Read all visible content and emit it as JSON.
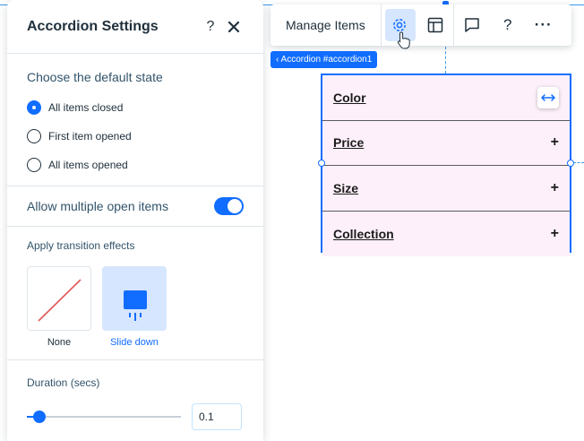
{
  "panel": {
    "title": "Accordion Settings",
    "help_label": "?",
    "close_label": "✕",
    "default_state": {
      "label": "Choose the default state",
      "options": [
        {
          "label": "All items closed",
          "checked": true
        },
        {
          "label": "First item opened",
          "checked": false
        },
        {
          "label": "All items opened",
          "checked": false
        }
      ]
    },
    "multiple_open": {
      "label": "Allow multiple open items",
      "enabled": true
    },
    "transition": {
      "label": "Apply transition effects",
      "options": [
        {
          "label": "None",
          "selected": false
        },
        {
          "label": "Slide down",
          "selected": true
        }
      ]
    },
    "duration": {
      "label": "Duration (secs)",
      "value": "0.1",
      "slider_fraction": 0.08
    }
  },
  "toolbar": {
    "manage_label": "Manage Items",
    "icons": [
      "gear-icon",
      "layout-icon",
      "comment-icon",
      "help-icon",
      "more-icon"
    ],
    "help_label": "?",
    "more_label": "···"
  },
  "breadcrumb": {
    "label": "‹ Accordion #accordion1"
  },
  "accordion": {
    "items": [
      {
        "title": "Color",
        "control": "stretch"
      },
      {
        "title": "Price",
        "control": "+"
      },
      {
        "title": "Size",
        "control": "+"
      },
      {
        "title": "Collection",
        "control": "+"
      }
    ],
    "item_background": "#fdf0fa"
  },
  "colors": {
    "accent": "#116dff",
    "accent_light": "#d6e6fe",
    "text": "#20303c"
  }
}
